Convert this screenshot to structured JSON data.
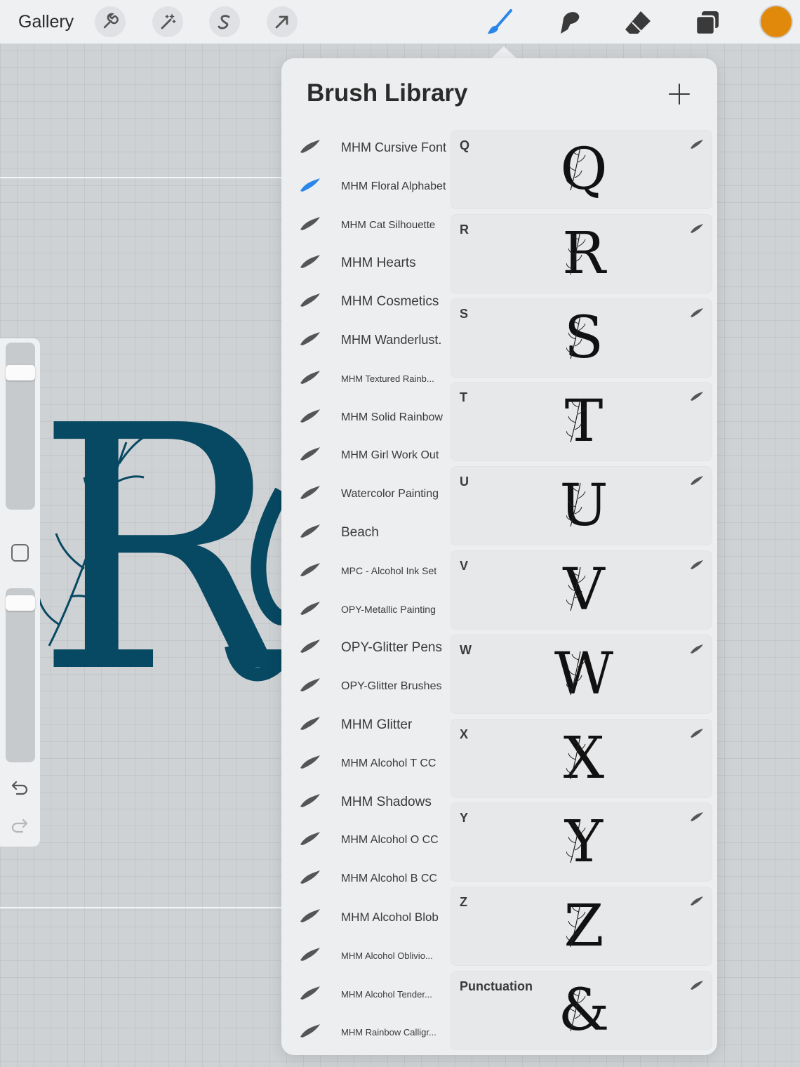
{
  "topbar": {
    "gallery_label": "Gallery",
    "left_tools": [
      {
        "name": "wrench-icon"
      },
      {
        "name": "magic-wand-icon"
      },
      {
        "name": "selection-s-icon"
      },
      {
        "name": "transform-arrow-icon"
      }
    ],
    "right_tools": [
      {
        "name": "brush-icon",
        "active": true
      },
      {
        "name": "smudge-icon",
        "active": false
      },
      {
        "name": "eraser-icon",
        "active": false
      },
      {
        "name": "layers-icon",
        "active": false
      }
    ],
    "current_color": "#e0890a"
  },
  "canvas": {
    "art_letter": "R",
    "art_color": "#074862"
  },
  "side_panel": {
    "brush_size": 0.85,
    "opacity": 1.0
  },
  "brush_library": {
    "title": "Brush Library",
    "accent_color": "#2a86e8",
    "sets": [
      {
        "label": "MHM Cursive Font",
        "size": 18,
        "selected": false
      },
      {
        "label": "MHM Floral Alphabet",
        "size": 16,
        "selected": true
      },
      {
        "label": "MHM Cat Silhouette",
        "size": 15,
        "selected": false
      },
      {
        "label": "MHM Hearts",
        "size": 19,
        "selected": false
      },
      {
        "label": "MHM Cosmetics",
        "size": 19,
        "selected": false
      },
      {
        "label": "MHM Wanderlust.",
        "size": 18,
        "selected": false
      },
      {
        "label": "MHM Textured Rainb...",
        "size": 13,
        "selected": false
      },
      {
        "label": "MHM Solid Rainbow",
        "size": 16,
        "selected": false
      },
      {
        "label": "MHM Girl Work Out",
        "size": 16,
        "selected": false
      },
      {
        "label": "Watercolor Painting",
        "size": 16,
        "selected": false
      },
      {
        "label": "Beach",
        "size": 19,
        "selected": false
      },
      {
        "label": "MPC - Alcohol Ink Set",
        "size": 14,
        "selected": false
      },
      {
        "label": "OPY-Metallic Painting",
        "size": 14,
        "selected": false
      },
      {
        "label": "OPY-Glitter Pens",
        "size": 19,
        "selected": false
      },
      {
        "label": "OPY-Glitter Brushes",
        "size": 16,
        "selected": false
      },
      {
        "label": "MHM Glitter",
        "size": 19,
        "selected": false
      },
      {
        "label": "MHM Alcohol T CC",
        "size": 16,
        "selected": false
      },
      {
        "label": "MHM Shadows",
        "size": 19,
        "selected": false
      },
      {
        "label": "MHM Alcohol O CC",
        "size": 16,
        "selected": false
      },
      {
        "label": "MHM Alcohol B CC",
        "size": 16,
        "selected": false
      },
      {
        "label": "MHM Alcohol Blob",
        "size": 17,
        "selected": false
      },
      {
        "label": "MHM Alcohol Oblivio...",
        "size": 13,
        "selected": false
      },
      {
        "label": "MHM Alcohol Tender...",
        "size": 13,
        "selected": false
      },
      {
        "label": "MHM Rainbow Calligr...",
        "size": 13,
        "selected": false
      }
    ],
    "brushes": [
      {
        "name": "Q",
        "glyph": "Q"
      },
      {
        "name": "R",
        "glyph": "R"
      },
      {
        "name": "S",
        "glyph": "S"
      },
      {
        "name": "T",
        "glyph": "T"
      },
      {
        "name": "U",
        "glyph": "U"
      },
      {
        "name": "V",
        "glyph": "V"
      },
      {
        "name": "W",
        "glyph": "W"
      },
      {
        "name": "X",
        "glyph": "X"
      },
      {
        "name": "Y",
        "glyph": "Y"
      },
      {
        "name": "Z",
        "glyph": "Z"
      },
      {
        "name": "Punctuation",
        "glyph": "&"
      }
    ]
  }
}
